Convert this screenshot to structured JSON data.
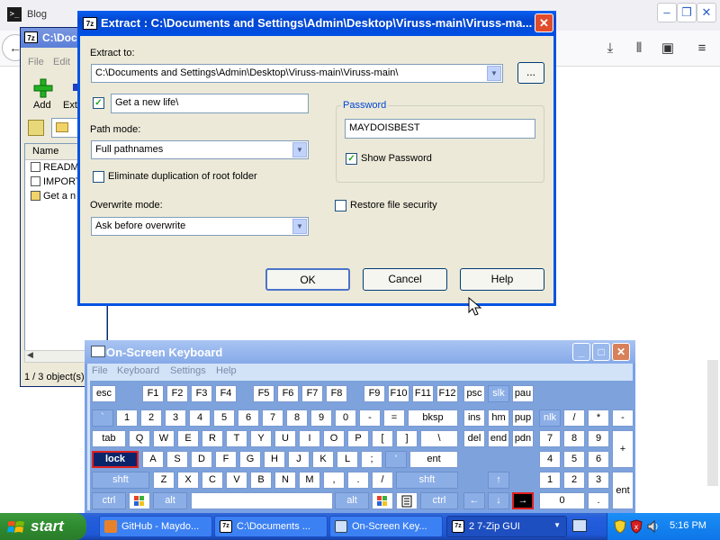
{
  "browser": {
    "title": "Blog"
  },
  "file_manager": {
    "title": "C:\\Docu",
    "menu": [
      "File",
      "Edit"
    ],
    "tools": [
      "Add",
      "Ext"
    ],
    "column": "Name",
    "rows": [
      "README",
      "IMPORT",
      "Get a n"
    ],
    "status": "1 / 3 object(s)"
  },
  "extract": {
    "title": "Extract : C:\\Documents and Settings\\Admin\\Desktop\\Viruss-main\\Viruss-ma...",
    "extract_to_label": "Extract to:",
    "extract_to_value": "C:\\Documents and Settings\\Admin\\Desktop\\Viruss-main\\Viruss-main\\",
    "browse_label": "...",
    "subfolder_value": "Get a new life\\",
    "path_mode_label": "Path mode:",
    "path_mode_value": "Full pathnames",
    "eliminate_label": "Eliminate duplication of root folder",
    "overwrite_label": "Overwrite mode:",
    "overwrite_value": "Ask before overwrite",
    "password_group": "Password",
    "password_value": "MAYDOISBEST",
    "show_password_label": "Show Password",
    "restore_label": "Restore file security",
    "ok": "OK",
    "cancel": "Cancel",
    "help": "Help"
  },
  "osk": {
    "title": "On-Screen Keyboard",
    "menu": [
      "File",
      "Keyboard",
      "Settings",
      "Help"
    ],
    "keys": {
      "esc": "esc",
      "f1": "F1",
      "f2": "F2",
      "f3": "F3",
      "f4": "F4",
      "f5": "F5",
      "f6": "F6",
      "f7": "F7",
      "f8": "F8",
      "f9": "F9",
      "f10": "F10",
      "f11": "F11",
      "f12": "F12",
      "psc": "psc",
      "slk": "slk",
      "pau": "pau",
      "grave": "`",
      "d1": "1",
      "d2": "2",
      "d3": "3",
      "d4": "4",
      "d5": "5",
      "d6": "6",
      "d7": "7",
      "d8": "8",
      "d9": "9",
      "d0": "0",
      "minus": "-",
      "equal": "=",
      "bksp": "bksp",
      "ins": "ins",
      "hm": "hm",
      "pup": "pup",
      "nlk": "nlk",
      "slash": "/",
      "star": "*",
      "nminus": "-",
      "tab": "tab",
      "q": "Q",
      "w": "W",
      "e": "E",
      "r": "R",
      "t": "T",
      "y": "Y",
      "u": "U",
      "i": "I",
      "o": "O",
      "p": "P",
      "lbr": "[",
      "rbr": "]",
      "bslash": "\\",
      "del": "del",
      "end": "end",
      "pdn": "pdn",
      "n7": "7",
      "n8": "8",
      "n9": "9",
      "plus": "+",
      "lock": "lock",
      "a": "A",
      "s": "S",
      "d": "D",
      "f": "F",
      "g": "G",
      "h": "H",
      "j": "J",
      "k": "K",
      "l": "L",
      "semi": ";",
      "quote": "'",
      "ent": "ent",
      "n4": "4",
      "n5": "5",
      "n6": "6",
      "shft": "shft",
      "z": "Z",
      "x": "X",
      "c": "C",
      "v": "V",
      "b": "B",
      "n": "N",
      "m": "M",
      "comma": ",",
      "period": ".",
      "fslash": "/",
      "rshft": "shft",
      "up": "↑",
      "n1": "1",
      "n2": "2",
      "n3": "3",
      "nent": "ent",
      "ctrl": "ctrl",
      "alt": "alt",
      "ralt": "alt",
      "rctrl": "ctrl",
      "left": "←",
      "down": "↓",
      "right": "→",
      "n0": "0",
      "ndot": "."
    }
  },
  "taskbar": {
    "start": "start",
    "tasks": [
      "GitHub - Maydo...",
      "C:\\Documents ...",
      "On-Screen Key...",
      "2 7-Zip GUI"
    ],
    "clock": "5:16 PM"
  }
}
